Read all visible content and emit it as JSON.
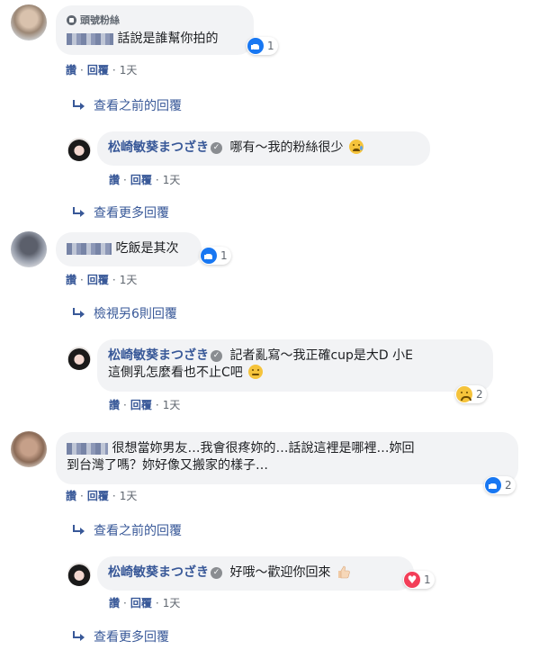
{
  "comments": [
    {
      "badge": "頭號粉絲",
      "text": "話說是誰幫你拍的",
      "reaction_count": "1",
      "actions": {
        "like": "讚",
        "reply": "回覆",
        "time": "1天"
      },
      "more": "查看之前的回覆",
      "reply": {
        "author": "松崎敏葵まつざき",
        "text": "哪有～我的粉絲很少",
        "actions": {
          "like": "讚",
          "reply": "回覆",
          "time": "1天"
        },
        "more": "查看更多回覆"
      }
    },
    {
      "text": "吃飯是其次",
      "reaction_count": "1",
      "actions": {
        "like": "讚",
        "reply": "回覆",
        "time": "1天"
      },
      "more": "檢視另6則回覆",
      "reply": {
        "author": "松崎敏葵まつざき",
        "text_line1": "記者亂寫～我正確cup是大D 小E",
        "text_line2": "這側乳怎麼看也不止C吧",
        "reaction_count": "2",
        "actions": {
          "like": "讚",
          "reply": "回覆",
          "time": "1天"
        }
      }
    },
    {
      "text_line1": "很想當妳男友…我會很疼妳的…話說這裡是哪裡…妳回",
      "text_line2": "到台灣了嗎？妳好像又搬家的樣子…",
      "reaction_count": "2",
      "actions": {
        "like": "讚",
        "reply": "回覆",
        "time": "1天"
      },
      "more": "查看之前的回覆",
      "reply": {
        "author": "松崎敏葵まつざき",
        "text": "好哦～歡迎你回來",
        "reaction_count": "1",
        "actions": {
          "like": "讚",
          "reply": "回覆",
          "time": "1天"
        },
        "more": "查看更多回覆"
      }
    }
  ],
  "colors": {
    "link": "#385898",
    "bubble": "#f2f3f5",
    "like": "#1877f2",
    "love": "#f33e58"
  }
}
